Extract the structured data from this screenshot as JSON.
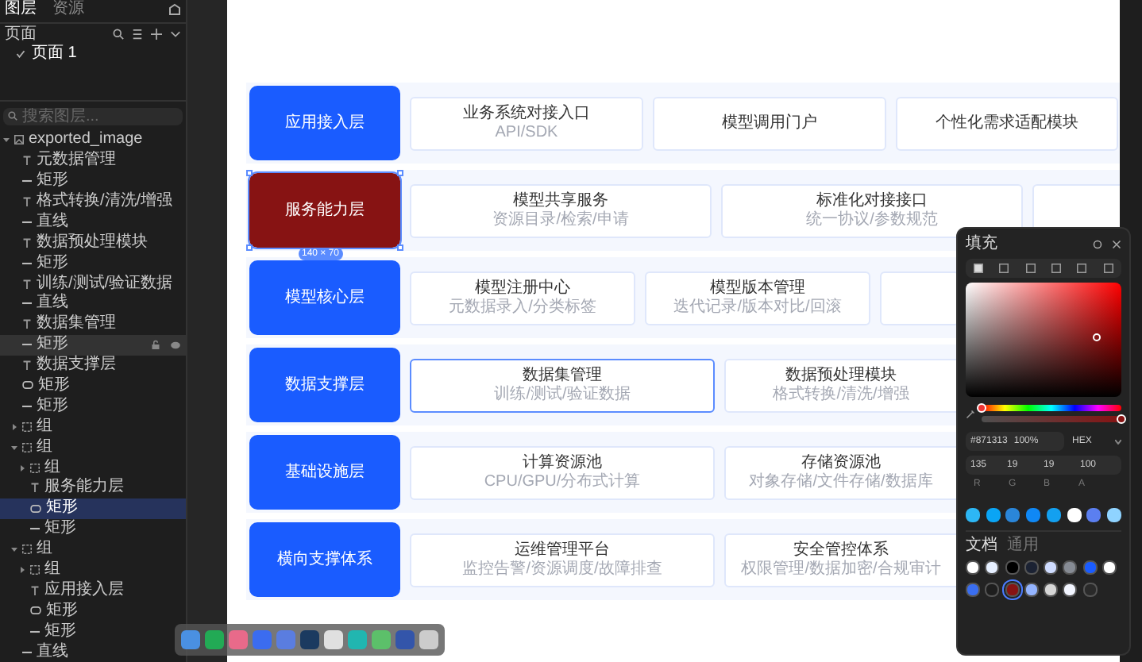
{
  "layers_panel": {
    "tabs": [
      {
        "label": "图层",
        "selected": true
      },
      {
        "label": "资源",
        "selected": false
      }
    ],
    "pages_title": "页面",
    "pages": [
      {
        "label": "页面 1",
        "selected": true
      }
    ],
    "search": {
      "placeholder": "搜索图层..."
    },
    "tree": [
      {
        "label": "exported_image",
        "kind": "image",
        "expanded": true,
        "selected": false,
        "children": [
          {
            "label": "元数据管理",
            "kind": "text",
            "selected": false
          },
          {
            "label": "矩形",
            "kind": "line",
            "selected": false
          },
          {
            "label": "格式转换/清洗/增强",
            "kind": "text",
            "selected": false
          },
          {
            "label": "直线",
            "kind": "line",
            "selected": false
          },
          {
            "label": "数据预处理模块",
            "kind": "text",
            "selected": false
          },
          {
            "label": "矩形",
            "kind": "line",
            "selected": false
          },
          {
            "label": "训练/测试/验证数据",
            "kind": "text",
            "selected": false
          },
          {
            "label": "直线",
            "kind": "line",
            "selected": false
          },
          {
            "label": "数据集管理",
            "kind": "text",
            "selected": false
          },
          {
            "label": "矩形",
            "kind": "line",
            "selected": false,
            "hovered": true
          },
          {
            "label": "数据支撑层",
            "kind": "text",
            "selected": false
          },
          {
            "label": "矩形",
            "kind": "rect",
            "selected": false
          },
          {
            "label": "矩形",
            "kind": "line",
            "selected": false
          },
          {
            "label": "组",
            "kind": "group",
            "expanded": false,
            "selected": false
          },
          {
            "label": "组",
            "kind": "group",
            "expanded": true,
            "selected": false,
            "children": [
              {
                "label": "组",
                "kind": "group",
                "expanded": false,
                "selected": false
              },
              {
                "label": "服务能力层",
                "kind": "text",
                "selected": false
              },
              {
                "label": "矩形",
                "kind": "rect",
                "selected": true
              },
              {
                "label": "矩形",
                "kind": "line",
                "selected": false
              }
            ]
          },
          {
            "label": "组",
            "kind": "group",
            "expanded": true,
            "selected": false,
            "children": [
              {
                "label": "组",
                "kind": "group",
                "expanded": false,
                "selected": false
              },
              {
                "label": "应用接入层",
                "kind": "text",
                "selected": false
              },
              {
                "label": "矩形",
                "kind": "rect",
                "selected": false
              },
              {
                "label": "矩形",
                "kind": "line",
                "selected": false
              }
            ]
          },
          {
            "label": "直线",
            "kind": "line",
            "selected": false
          }
        ]
      }
    ]
  },
  "diagram": {
    "rows": [
      {
        "label": "应用接入层",
        "color": "#1a5cff",
        "selected": false,
        "cards": [
          {
            "title": "业务系统对接入口",
            "subtitle": "API/SDK"
          },
          {
            "title": "模型调用门户"
          },
          {
            "title": "个性化需求适配模块"
          }
        ]
      },
      {
        "label": "服务能力层",
        "color": "#871313",
        "selected": true,
        "size_badge": "140 × 70",
        "cards": [
          {
            "title": "模型共享服务",
            "subtitle": "资源目录/检索/申请"
          },
          {
            "title": "标准化对接接口",
            "subtitle": "统一协议/参数规范"
          }
        ]
      },
      {
        "label": "模型核心层",
        "color": "#1a5cff",
        "selected": false,
        "cards": [
          {
            "title": "模型注册中心",
            "subtitle": "元数据录入/分类标签"
          },
          {
            "title": "模型版本管理",
            "subtitle": "迭代记录/版本对比/回滚"
          }
        ]
      },
      {
        "label": "数据支撑层",
        "color": "#1a5cff",
        "selected": false,
        "cards": [
          {
            "title": "数据集管理",
            "subtitle": "训练/测试/验证数据",
            "hovered": true
          },
          {
            "title": "数据预处理模块",
            "subtitle": "格式转换/清洗/增强"
          }
        ]
      },
      {
        "label": "基础设施层",
        "color": "#1a5cff",
        "selected": false,
        "cards": [
          {
            "title": "计算资源池",
            "subtitle": "CPU/GPU/分布式计算"
          },
          {
            "title": "存储资源池",
            "subtitle": "对象存储/文件存储/数据库"
          }
        ]
      },
      {
        "label": "横向支撑体系",
        "color": "#1a5cff",
        "selected": false,
        "cards": [
          {
            "title": "运维管理平台",
            "subtitle": "监控告警/资源调度/故障排查"
          },
          {
            "title": "安全管控体系",
            "subtitle": "权限管理/数据加密/合规审计"
          }
        ]
      }
    ]
  },
  "fill_panel": {
    "title": "填充",
    "hex": "#871313",
    "opacity": "100%",
    "format": "HEX",
    "rgba": [
      "135",
      "19",
      "19",
      "100"
    ],
    "hue": {
      "level": 0
    },
    "opacity_slider": {
      "level": 1
    },
    "channel_labels": [
      "R",
      "G",
      "B",
      "A"
    ],
    "recent": [
      {
        "color": "#2db7f5"
      },
      {
        "color": "#0aa5f5"
      },
      {
        "color": "#2a86d9"
      },
      {
        "color": "#0f88f5"
      },
      {
        "color": "#13a0f0"
      },
      {
        "color": "#ffffff"
      },
      {
        "color": "#5b7ff0"
      },
      {
        "color": "#8fd3ff"
      }
    ],
    "library_tabs": [
      {
        "label": "文档",
        "selected": true
      },
      {
        "label": "通用",
        "selected": false
      }
    ],
    "swatches": [
      {
        "color": "#ffffff",
        "selected": false
      },
      {
        "color": "#e6efff",
        "selected": false
      },
      {
        "color": "#000000",
        "selected": false
      },
      {
        "color": "#1b2233",
        "selected": false
      },
      {
        "color": "#cfdcff",
        "selected": false
      },
      {
        "color": "#868b94",
        "selected": false
      },
      {
        "color": "#1a5cff",
        "selected": false
      },
      {
        "color": "#ffffff",
        "selected": false
      },
      {
        "color": "#3a6ef0",
        "selected": false
      },
      {
        "color": "#1e1e1e",
        "selected": false
      },
      {
        "color": "#871313",
        "selected": true
      },
      {
        "color": "#94b4ff",
        "selected": false
      },
      {
        "color": "#d6d6d6",
        "selected": false
      },
      {
        "color": "#f2f5ff",
        "selected": false
      },
      {
        "color": "#2a2a2a",
        "selected": false
      }
    ]
  }
}
